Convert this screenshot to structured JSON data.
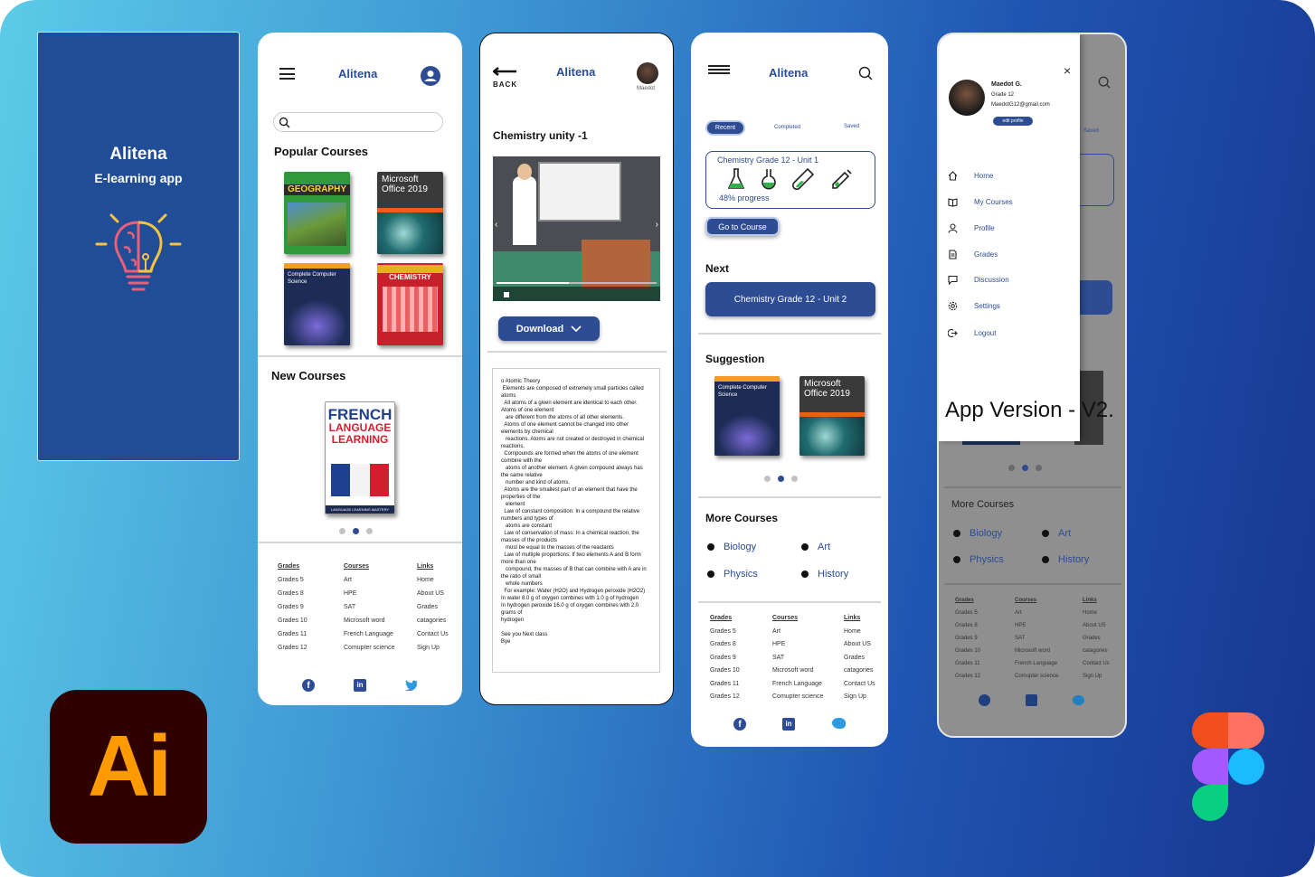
{
  "splash": {
    "title": "Alitena",
    "subtitle": "E-learning app"
  },
  "home": {
    "app_title": "Alitena",
    "popular_title": "Popular Courses",
    "books": [
      {
        "title": "GEOGRAPHY",
        "color": "#2e9a3c"
      },
      {
        "title": "Microsoft Office 2019",
        "color": "#3a3a3a"
      },
      {
        "title": "Complete Computer Science",
        "color": "#1c2c55"
      },
      {
        "title": "CHEMISTRY",
        "color": "#c8202a"
      }
    ],
    "new_title": "New Courses",
    "new_book": {
      "line1": "FRENCH",
      "line2": "LANGUAGE",
      "line3": "LEARNING",
      "footer": "LANGUAGE LEARNING MASTERY"
    }
  },
  "footer": {
    "grades_title": "Grades",
    "grades": [
      "Grades 5",
      "Grades 8",
      "Grades 9",
      "Grades 10",
      "Grades 11",
      "Grades 12"
    ],
    "courses_title": "Courses",
    "courses": [
      "Art",
      "HPE",
      "SAT",
      "Microsoft word",
      "French Language",
      "Comupter science"
    ],
    "links_title": "Links",
    "links": [
      "Home",
      "About  US",
      "Grades",
      "catagories",
      "Contact Us",
      "Sign Up"
    ]
  },
  "lesson": {
    "back_label": "BACK",
    "app_title": "Alitena",
    "avatar_name": "Maedot",
    "title": "Chemistry unity -1",
    "download_label": "Download",
    "content": "o Atomic Theory\n Elements are composed of extremely small particles called atoms\n  All atoms of a given element are identical to each other. Atoms of one element\n   are different from the atoms of all other elements.\n  Atoms of one element cannot be changed into other elements by chemical\n   reactions. Atoms are not created or destroyed in chemical reactions.\n  Compounds are formed when the atoms of one element combine with the\n   atoms of another element. A given compound always has the same relative\n   number and kind of atoms.\n  Atoms are the smallest part of an element that have the properties of the\n   element\n  Law of constant composition: In a compound the relative numbers and types of\n   atoms are constant\n  Law of conservation of mass: In a chemical reaction, the masses of the products\n   must be equal to the masses of the reactants\n  Law of multiple proportions: If two elements A and B form more than one\n   compound, the masses of B that can combine with A are in the ratio of small\n   whole numbers\n  For example: Water (H2O) and Hydrogen peroxide (H2O2)\nIn water 8.0 g of oxygen combines with 1.0 g of hydrogen\nIn hydrogen peroxide 16.0 g of oxygen combines with 2.0 grams of\nhydrogen\n\nSee you Next class\nBye"
  },
  "mycourses": {
    "app_title": "Alitena",
    "tabs": [
      "Recent",
      "Completed",
      "Saved"
    ],
    "course_title": "Chemistry Grade 12 - Unit 1",
    "progress_text": "48% progress",
    "go_label": "Go to Course",
    "next_title": "Next",
    "next_course": "Chemistry Grade 12 - Unit 2",
    "suggestion_title": "Suggestion",
    "more_title": "More Courses",
    "more": [
      "Biology",
      "Art",
      "Physics",
      "History"
    ]
  },
  "drawer": {
    "name": "Maedot G.",
    "grade": "Grade 12",
    "email": "MaedotG12@gmail.com",
    "edit_label": "edit profile",
    "close": "×",
    "items": [
      "Home",
      "My Courses",
      "Profile",
      "Grades",
      "Discussion",
      "Settings",
      "Logout"
    ],
    "version": "App Version - V2.",
    "bg_saved": "Saved",
    "bg_more": "More Courses",
    "bg_more_items": [
      "Biology",
      "Art",
      "Physics",
      "History"
    ]
  },
  "badges": {
    "ai": "Ai"
  }
}
